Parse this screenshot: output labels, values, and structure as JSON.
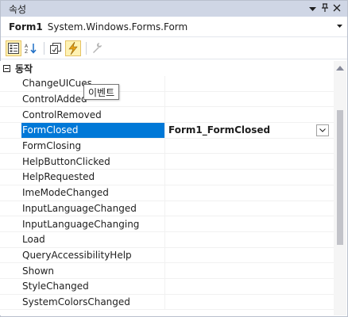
{
  "panel": {
    "title": "속성",
    "buttons": {
      "dropdown": "▾",
      "pin": "ᅟ",
      "close": "✕"
    }
  },
  "object_selector": {
    "name": "Form1",
    "type": "System.Windows.Forms.Form"
  },
  "toolbar": {
    "buttons": [
      "categorized-icon",
      "alphabetical-icon",
      "properties-icon",
      "events-icon",
      "property-pages-icon"
    ],
    "active": "events-icon"
  },
  "category": {
    "label": "동작"
  },
  "rows": [
    {
      "name": "ChangeUICues",
      "value": ""
    },
    {
      "name": "ControlAdded",
      "value": ""
    },
    {
      "name": "ControlRemoved",
      "value": ""
    },
    {
      "name": "FormClosed",
      "value": "Form1_FormClosed"
    },
    {
      "name": "FormClosing",
      "value": ""
    },
    {
      "name": "HelpButtonClicked",
      "value": ""
    },
    {
      "name": "HelpRequested",
      "value": ""
    },
    {
      "name": "ImeModeChanged",
      "value": ""
    },
    {
      "name": "InputLanguageChanged",
      "value": ""
    },
    {
      "name": "InputLanguageChanging",
      "value": ""
    },
    {
      "name": "Load",
      "value": ""
    },
    {
      "name": "QueryAccessibilityHelp",
      "value": ""
    },
    {
      "name": "Shown",
      "value": ""
    },
    {
      "name": "StyleChanged",
      "value": ""
    },
    {
      "name": "SystemColorsChanged",
      "value": ""
    }
  ],
  "selected_row": "FormClosed",
  "tooltip": {
    "text": "이벤트"
  },
  "colors": {
    "selection": "#0078d7",
    "titlebar": "#cfd6e5",
    "events_icon": "#e8a317"
  }
}
